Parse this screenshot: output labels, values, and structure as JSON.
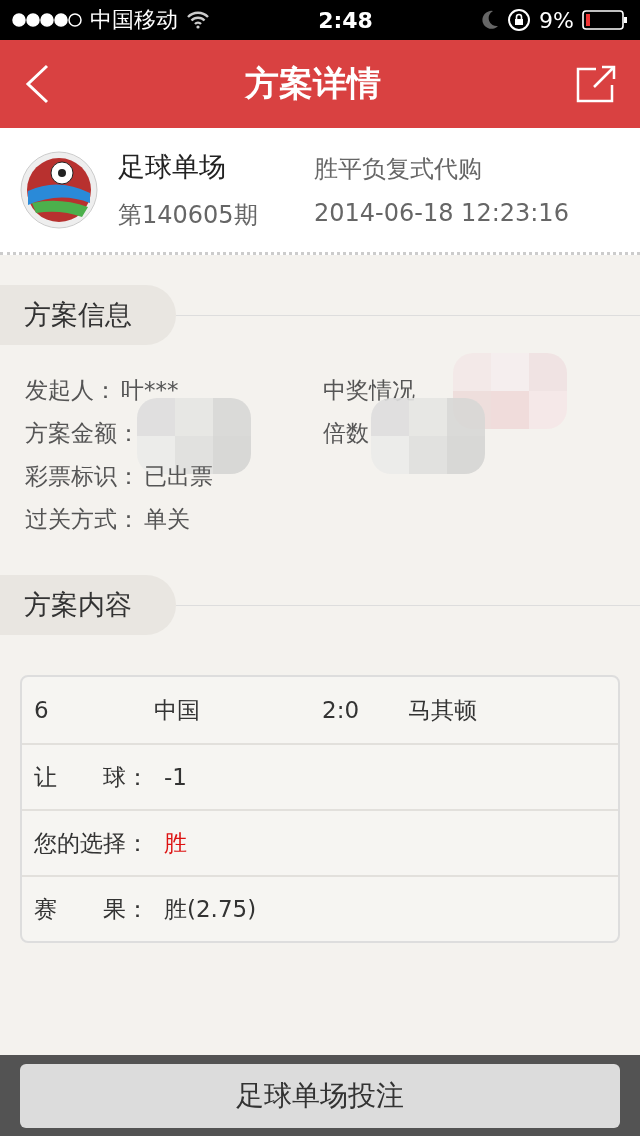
{
  "status_bar": {
    "carrier": "中国移动",
    "time": "2:48",
    "battery": "9%"
  },
  "header": {
    "title": "方案详情"
  },
  "plan": {
    "name": "足球单场",
    "issue": "第140605期",
    "type": "胜平负复式代购",
    "time": "2014-06-18 12:23:16"
  },
  "info_section": {
    "title": "方案信息",
    "rows": [
      [
        {
          "label": "发起人：",
          "value": "叶***",
          "redacted": false
        },
        {
          "label": "中奖情况",
          "redacted": true
        }
      ],
      [
        {
          "label": "方案金额：",
          "redacted": true
        },
        {
          "label": "倍数",
          "redacted": true
        }
      ],
      [
        {
          "label": "彩票标识：",
          "value": "已出票",
          "redacted": false
        }
      ],
      [
        {
          "label": "过关方式：",
          "value": "单关",
          "redacted": false
        }
      ]
    ]
  },
  "content_section": {
    "title": "方案内容",
    "match": {
      "number": "6",
      "home": "中国",
      "score": "2:0",
      "away": "马其顿"
    },
    "rows": [
      {
        "label": "让　　球：",
        "value": "-1",
        "kind": "plain"
      },
      {
        "label": "您的选择：",
        "value": "胜",
        "kind": "highlight"
      },
      {
        "label": "赛　　果：",
        "value": "胜(2.75)",
        "kind": "plain"
      }
    ]
  },
  "bottom_button": "足球单场投注"
}
